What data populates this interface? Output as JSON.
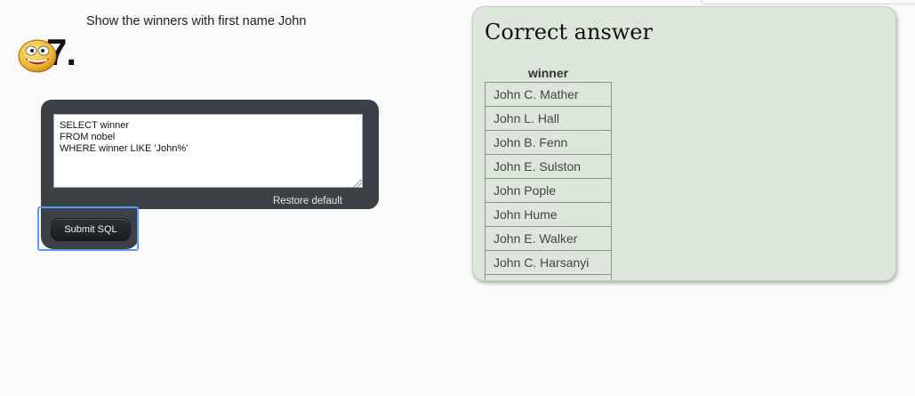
{
  "question": {
    "number": "7.",
    "text": "Show the winners with first name John"
  },
  "sql_editor": {
    "value": "SELECT winner\nFROM nobel\nWHERE winner LIKE 'John%'",
    "restore_label": "Restore default"
  },
  "submit": {
    "label": "Submit SQL"
  },
  "answer": {
    "title": "Correct answer",
    "column_header": "winner",
    "rows": [
      "John C. Mather",
      "John L. Hall",
      "John B. Fenn",
      "John E. Sulston",
      "John Pople",
      "John Hume",
      "John E. Walker",
      "John C. Harsanyi",
      ""
    ]
  },
  "colors": {
    "editor_frame": "#3b4147",
    "answer_panel_bg": "#dde6db",
    "focus_ring": "#5b9af5"
  },
  "icons": {
    "question_marker": "smiley-icon"
  }
}
